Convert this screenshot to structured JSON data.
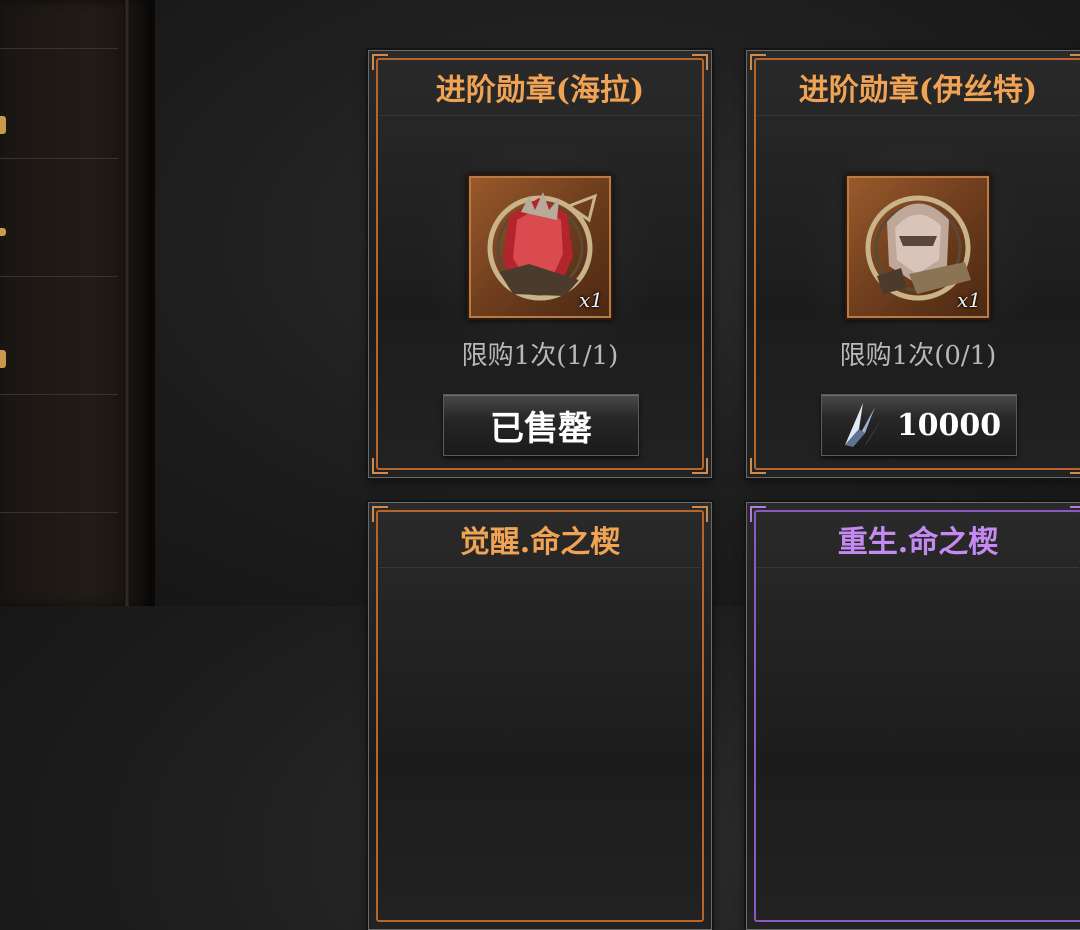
{
  "cards": [
    {
      "title": "进阶勋章(海拉)",
      "quantity": "x1",
      "limit_text": "限购1次(1/1)",
      "button_label": "已售罄",
      "state": "sold-out",
      "frame_color": "#b8652c"
    },
    {
      "title": "进阶勋章(伊丝特)",
      "quantity": "x1",
      "limit_text": "限购1次(0/1)",
      "price": "10000",
      "currency_icon": "crystal-icon",
      "state": "purchasable",
      "frame_color": "#b8652c"
    },
    {
      "title": "觉醒.命之楔",
      "frame_color": "#b8652c"
    },
    {
      "title": "重生.命之楔",
      "frame_color": "#8e58c2"
    }
  ]
}
